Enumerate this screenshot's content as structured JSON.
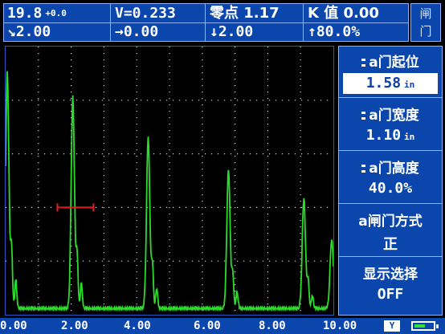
{
  "status": {
    "gain": "19.8",
    "gain_delta": "+0.0",
    "velocity": "V=0.233",
    "zero": "零点 1.17",
    "k_value": "K 值 0.00",
    "path": "2.00",
    "horizontal": "0.00",
    "depth": "2.00",
    "amplitude": "80.0%"
  },
  "gate_badge": [
    "闸",
    "门"
  ],
  "menu": {
    "items": [
      {
        "label": "a门起位",
        "value": "1.58",
        "unit": "in",
        "bullet": true,
        "boxed": true
      },
      {
        "label": "a门宽度",
        "value": "1.10",
        "unit": "in",
        "bullet": true,
        "boxed": false
      },
      {
        "label": "a门高度",
        "value": "40.0%",
        "unit": "",
        "bullet": true,
        "boxed": false
      },
      {
        "label": "a闸门方式",
        "value": "正",
        "unit": "",
        "bullet": false,
        "boxed": false
      },
      {
        "label": "显示选择",
        "value": "OFF",
        "unit": "",
        "bullet": false,
        "boxed": false
      }
    ]
  },
  "x_axis": [
    "0.00",
    "2.00",
    "4.00",
    "6.00",
    "8.00",
    "10.00"
  ],
  "indicator": "Y",
  "battery_level": 0.6,
  "colors": {
    "panel": "#0b46ad",
    "signal": "#2bdc2b",
    "gate": "#e02020",
    "grid": "#d8d8d8"
  },
  "chart_data": {
    "type": "line",
    "x_range": [
      0,
      10
    ],
    "y_range": [
      0,
      100
    ],
    "grid": true,
    "gate": {
      "start": 1.58,
      "width": 1.1,
      "height": 40.0
    },
    "peaks": [
      {
        "x": 0.05,
        "y": 88
      },
      {
        "x": 2.05,
        "y": 79
      },
      {
        "x": 4.35,
        "y": 64
      },
      {
        "x": 6.8,
        "y": 52
      },
      {
        "x": 9.1,
        "y": 41
      },
      {
        "x": 9.95,
        "y": 26
      }
    ]
  }
}
